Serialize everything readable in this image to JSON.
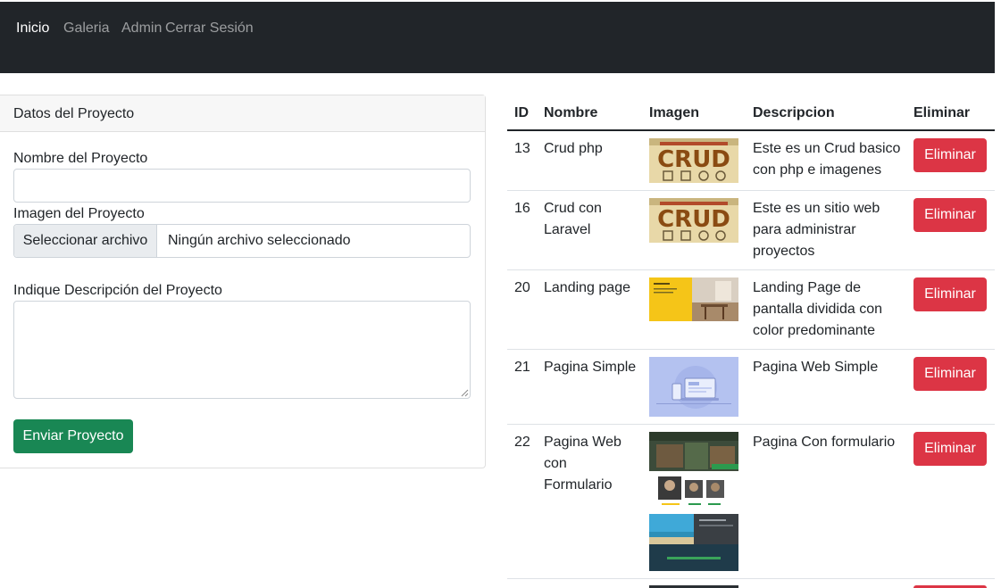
{
  "nav": {
    "items": [
      "Inicio",
      "Galeria",
      "Admin",
      "Cerrar Sesión"
    ]
  },
  "form": {
    "card_title": "Datos del Proyecto",
    "name_label": "Nombre del Proyecto",
    "name_value": "",
    "image_label": "Imagen del Proyecto",
    "file_button": "Seleccionar archivo",
    "file_status": "Ningún archivo seleccionado",
    "desc_label": "Indique Descripción del Proyecto",
    "desc_value": "",
    "submit": "Enviar Proyecto"
  },
  "table": {
    "headers": [
      "ID",
      "Nombre",
      "Imagen",
      "Descripcion",
      "Eliminar"
    ],
    "rows": [
      {
        "id": "13",
        "nombre": "Crud php",
        "image": "crud-thumbnail",
        "descripcion": "Este es un Crud basico con php e imagenes",
        "action": "Eliminar"
      },
      {
        "id": "16",
        "nombre": "Crud con Laravel",
        "image": "crud-thumbnail",
        "descripcion": "Este es un sitio web para administrar proyectos",
        "action": "Eliminar"
      },
      {
        "id": "20",
        "nombre": "Landing page",
        "image": "landing-thumbnail",
        "descripcion": "Landing Page de pantalla dividida con color predominante",
        "action": "Eliminar"
      },
      {
        "id": "21",
        "nombre": "Pagina Simple",
        "image": "simple-thumbnail",
        "descripcion": "Pagina Web Simple",
        "action": "Eliminar"
      },
      {
        "id": "22",
        "nombre": "Pagina Web con Formulario",
        "image": "form-page-thumbnail",
        "descripcion": "Pagina Con formulario",
        "action": "Eliminar"
      }
    ]
  },
  "colors": {
    "navbar": "#212529",
    "success": "#198754",
    "danger": "#dc3545"
  }
}
